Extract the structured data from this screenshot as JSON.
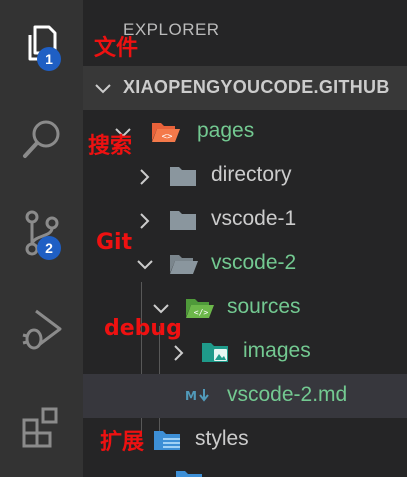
{
  "activity_bar": {
    "explorer_badge": "1",
    "scm_badge": "2"
  },
  "annotations": {
    "files": "文件",
    "search": "搜索",
    "git": "Git",
    "debug": "debug",
    "extensions": "扩展"
  },
  "explorer": {
    "title": "EXPLORER",
    "root_label": "XIAOPENGYOUCODE.GITHUB",
    "tree": [
      {
        "name": "pages",
        "color": "#73c991"
      },
      {
        "name": "directory",
        "color": "#cccccc"
      },
      {
        "name": "vscode-1",
        "color": "#cccccc"
      },
      {
        "name": "vscode-2",
        "color": "#73c991"
      },
      {
        "name": "sources",
        "color": "#73c991"
      },
      {
        "name": "images",
        "color": "#73c991"
      },
      {
        "name": "vscode-2.md",
        "color": "#73c991"
      },
      {
        "name": "styles",
        "color": "#cccccc"
      }
    ]
  },
  "colors": {
    "activity_bar": "#333333",
    "sidebar": "#252526",
    "git_added": "#73c991",
    "badge": "#1f5fc4",
    "annotation": "#ee1111"
  }
}
